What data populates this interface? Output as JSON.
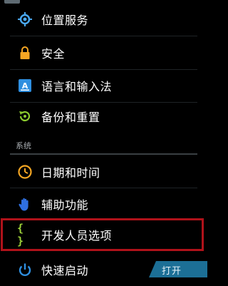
{
  "settings": {
    "items": [
      {
        "label": "位置服务",
        "icon": "location-icon"
      },
      {
        "label": "安全",
        "icon": "lock-icon"
      },
      {
        "label": "语言和输入法",
        "icon": "keyboard-icon"
      },
      {
        "label": "备份和重置",
        "icon": "backup-restore-icon"
      }
    ],
    "system_header": "系统",
    "system_items": [
      {
        "label": "日期和时间",
        "icon": "clock-icon"
      },
      {
        "label": "辅助功能",
        "icon": "hand-icon"
      },
      {
        "label": "开发人员选项",
        "icon": "braces-icon",
        "highlighted": true
      },
      {
        "label": "快速启动",
        "icon": "power-icon",
        "toggle": "打开"
      }
    ]
  },
  "colors": {
    "background": "#000000",
    "highlight_border": "#b0121a",
    "toggle_bg": "#1c6f96",
    "accent_blue": "#2f8fe0"
  }
}
